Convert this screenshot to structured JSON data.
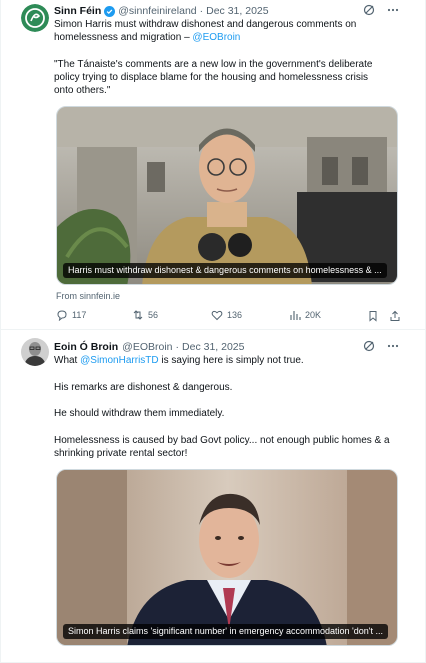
{
  "tweets": [
    {
      "author_name": "Sinn Féin",
      "handle": "@sinnfeinireland",
      "separator": "·",
      "date": "Dec 31, 2025",
      "lines": [
        {
          "text": "Simon Harris must withdraw dishonest and dangerous comments on",
          "mention": ""
        },
        {
          "text": "homelessness and migration – ",
          "mention": "@EOBroin"
        },
        {
          "text": "",
          "mention": ""
        },
        {
          "text": "\"The Tánaiste's comments are a new low in the government's deliberate",
          "mention": ""
        },
        {
          "text": "policy trying to displace blame for the housing and homelessness crisis",
          "mention": ""
        },
        {
          "text": "onto others.\"",
          "mention": ""
        }
      ],
      "media_caption": "Harris must withdraw dishonest & dangerous comments on homelessness & ...",
      "link_source": "From sinnfein.ie",
      "stats": {
        "replies": "117",
        "reposts": "56",
        "likes": "136",
        "views": "20K"
      }
    },
    {
      "author_name": "Eoin Ó Broin",
      "handle": "@EOBroin",
      "separator": "·",
      "date": "Dec 31, 2025",
      "lines": [
        {
          "pre": "What ",
          "mention": "@SimonHarrisTD",
          "post": " is saying here is simply not true."
        },
        {
          "pre": "",
          "mention": "",
          "post": ""
        },
        {
          "pre": "His remarks are dishonest & dangerous.",
          "mention": "",
          "post": ""
        },
        {
          "pre": "",
          "mention": "",
          "post": ""
        },
        {
          "pre": "He should withdraw them immediately.",
          "mention": "",
          "post": ""
        },
        {
          "pre": "",
          "mention": "",
          "post": ""
        },
        {
          "pre": "Homelessness is caused by bad Govt policy... not enough public homes & a",
          "mention": "",
          "post": ""
        },
        {
          "pre": "shrinking private rental sector!",
          "mention": "",
          "post": ""
        }
      ],
      "media_caption": "Simon Harris claims 'significant number' in emergency accommodation 'don't ..."
    }
  ],
  "colors": {
    "accent": "#1d9bf0",
    "sinn_fein_green": "#2e8b57",
    "muted": "#536471"
  },
  "icons": [
    "verified-badge-icon",
    "grok-icon",
    "more-icon",
    "reply-icon",
    "repost-icon",
    "like-icon",
    "views-icon",
    "bookmark-icon",
    "share-icon"
  ]
}
